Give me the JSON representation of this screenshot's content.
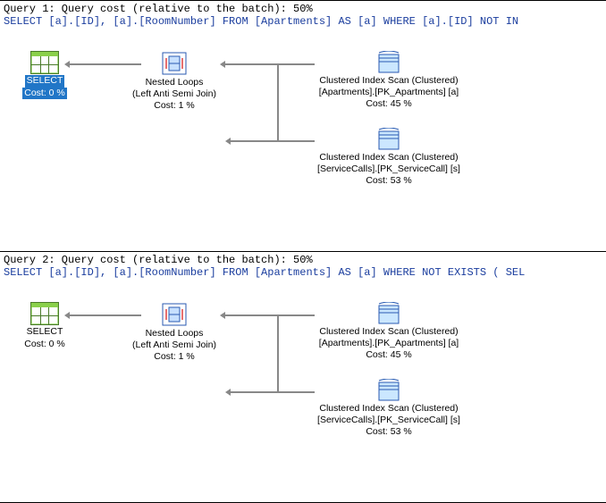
{
  "queries": [
    {
      "header": "Query 1: Query cost (relative to the batch): 50%",
      "sql": "SELECT [a].[ID], [a].[RoomNumber] FROM [Apartments] AS [a] WHERE [a].[ID] NOT IN",
      "selected": true,
      "nodes": {
        "select": {
          "label": "SELECT",
          "cost": "Cost: 0 %"
        },
        "loops": {
          "title": "Nested Loops",
          "subtitle": "(Left Anti Semi Join)",
          "cost": "Cost: 1 %"
        },
        "scan1": {
          "title": "Clustered Index Scan (Clustered)",
          "subtitle": "[Apartments].[PK_Apartments] [a]",
          "cost": "Cost: 45 %"
        },
        "scan2": {
          "title": "Clustered Index Scan (Clustered)",
          "subtitle": "[ServiceCalls].[PK_ServiceCall] [s]",
          "cost": "Cost: 53 %"
        }
      }
    },
    {
      "header": "Query 2: Query cost (relative to the batch): 50%",
      "sql": "SELECT [a].[ID], [a].[RoomNumber] FROM [Apartments] AS [a] WHERE NOT EXISTS ( SEL",
      "selected": false,
      "nodes": {
        "select": {
          "label": "SELECT",
          "cost": "Cost: 0 %"
        },
        "loops": {
          "title": "Nested Loops",
          "subtitle": "(Left Anti Semi Join)",
          "cost": "Cost: 1 %"
        },
        "scan1": {
          "title": "Clustered Index Scan (Clustered)",
          "subtitle": "[Apartments].[PK_Apartments] [a]",
          "cost": "Cost: 45 %"
        },
        "scan2": {
          "title": "Clustered Index Scan (Clustered)",
          "subtitle": "[ServiceCalls].[PK_ServiceCall] [s]",
          "cost": "Cost: 53 %"
        }
      }
    }
  ]
}
